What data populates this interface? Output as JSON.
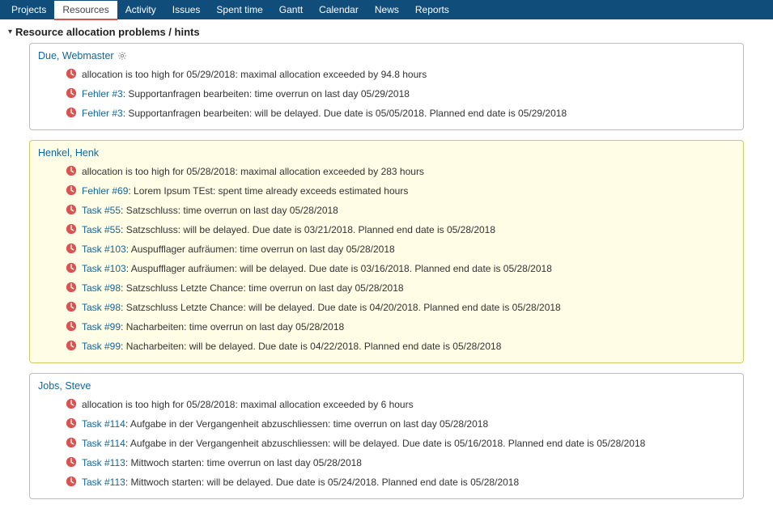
{
  "nav": {
    "items": [
      {
        "label": "Projects",
        "active": false
      },
      {
        "label": "Resources",
        "active": true
      },
      {
        "label": "Activity",
        "active": false
      },
      {
        "label": "Issues",
        "active": false
      },
      {
        "label": "Spent time",
        "active": false
      },
      {
        "label": "Gantt",
        "active": false
      },
      {
        "label": "Calendar",
        "active": false
      },
      {
        "label": "News",
        "active": false
      },
      {
        "label": "Reports",
        "active": false
      }
    ]
  },
  "section_title": "Resource allocation problems / hints",
  "panels": [
    {
      "title": "Due, Webmaster",
      "admin": true,
      "highlight": false,
      "hints": [
        {
          "link": "",
          "text": "allocation is too high for 05/29/2018: maximal allocation exceeded by 94.8 hours"
        },
        {
          "link": "Fehler #3",
          "text": ": Supportanfragen bearbeiten: time overrun on last day 05/29/2018"
        },
        {
          "link": "Fehler #3",
          "text": ": Supportanfragen bearbeiten: will be delayed. Due date is 05/05/2018. Planned end date is 05/29/2018"
        }
      ]
    },
    {
      "title": "Henkel, Henk",
      "admin": false,
      "highlight": true,
      "hints": [
        {
          "link": "",
          "text": "allocation is too high for 05/28/2018: maximal allocation exceeded by 283 hours"
        },
        {
          "link": "Fehler #69",
          "text": ": Lorem Ipsum TEst: spent time already exceeds estimated hours"
        },
        {
          "link": "Task #55",
          "text": ": Satzschluss: time overrun on last day 05/28/2018"
        },
        {
          "link": "Task #55",
          "text": ": Satzschluss: will be delayed. Due date is 03/21/2018. Planned end date is 05/28/2018"
        },
        {
          "link": "Task #103",
          "text": ": Auspufflager aufräumen: time overrun on last day 05/28/2018"
        },
        {
          "link": "Task #103",
          "text": ": Auspufflager aufräumen: will be delayed. Due date is 03/16/2018. Planned end date is 05/28/2018"
        },
        {
          "link": "Task #98",
          "text": ": Satzschluss Letzte Chance: time overrun on last day 05/28/2018"
        },
        {
          "link": "Task #98",
          "text": ": Satzschluss Letzte Chance: will be delayed. Due date is 04/20/2018. Planned end date is 05/28/2018"
        },
        {
          "link": "Task #99",
          "text": ": Nacharbeiten: time overrun on last day 05/28/2018"
        },
        {
          "link": "Task #99",
          "text": ": Nacharbeiten: will be delayed. Due date is 04/22/2018. Planned end date is 05/28/2018"
        }
      ]
    },
    {
      "title": "Jobs, Steve",
      "admin": false,
      "highlight": false,
      "hints": [
        {
          "link": "",
          "text": "allocation is too high for 05/28/2018: maximal allocation exceeded by 6 hours"
        },
        {
          "link": "Task #114",
          "text": ": Aufgabe in der Vergangenheit abzuschliessen: time overrun on last day 05/28/2018"
        },
        {
          "link": "Task #114",
          "text": ": Aufgabe in der Vergangenheit abzuschliessen: will be delayed. Due date is 05/16/2018. Planned end date is 05/28/2018"
        },
        {
          "link": "Task #113",
          "text": ": Mittwoch starten: time overrun on last day 05/28/2018"
        },
        {
          "link": "Task #113",
          "text": ": Mittwoch starten: will be delayed. Due date is 05/24/2018. Planned end date is 05/28/2018"
        }
      ]
    }
  ]
}
